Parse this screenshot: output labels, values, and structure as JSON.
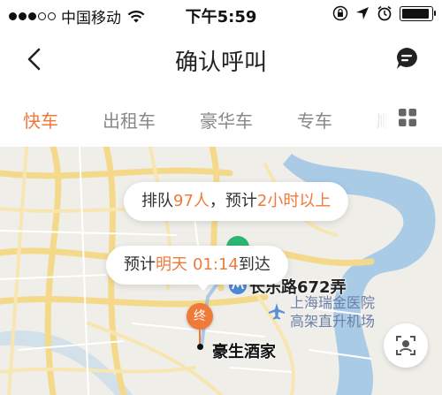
{
  "status_bar": {
    "carrier": "中国移动",
    "time": "下午5:59",
    "battery_level": 0.95
  },
  "nav": {
    "title": "确认呼叫",
    "back_icon": "chevron-left-icon",
    "message_icon": "message-icon"
  },
  "tabs": {
    "items": [
      {
        "label": "快车",
        "active": true
      },
      {
        "label": "出租车",
        "active": false
      },
      {
        "label": "豪华车",
        "active": false
      },
      {
        "label": "专车",
        "active": false
      },
      {
        "label": "顺",
        "active": false
      }
    ],
    "grid_icon": "grid-icon"
  },
  "map": {
    "queue": {
      "prefix": "排队",
      "count": "97人",
      "middle": "，预计",
      "wait": "2小时以上"
    },
    "eta": {
      "prefix": "预计",
      "day": "明天",
      "time": "01:14",
      "suffix": "到达"
    },
    "start_address": "长乐路672弄",
    "poi_line1": "上海瑞金医院",
    "poi_line2": "高架直升机场",
    "end_marker_label": "终",
    "destination": "豪生酒家"
  },
  "colors": {
    "accent": "#f07a3a",
    "start_green": "#2bb673"
  }
}
